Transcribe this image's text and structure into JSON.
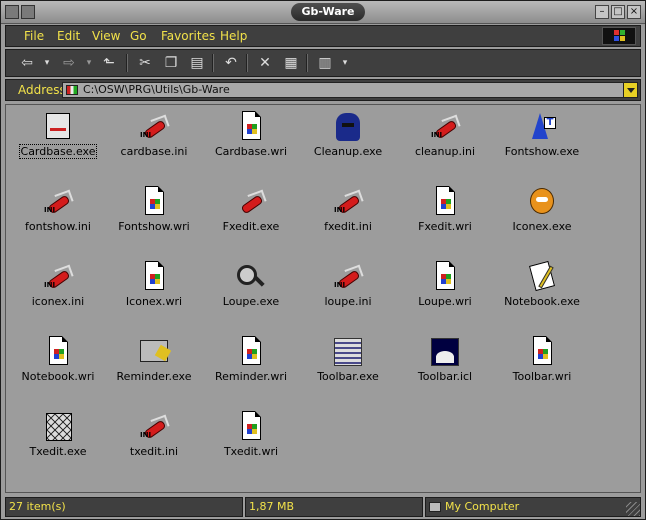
{
  "window": {
    "title": "Gb-Ware"
  },
  "menu": [
    {
      "label": "File"
    },
    {
      "label": "Edit"
    },
    {
      "label": "View"
    },
    {
      "label": "Go"
    },
    {
      "label": "Favorites"
    },
    {
      "label": "Help"
    }
  ],
  "address": {
    "label": "Address",
    "value": "C:\\OSW\\PRG\\Utils\\Gb-Ware"
  },
  "files": [
    {
      "name": "Cardbase.exe",
      "icon": "cardbase-icon",
      "selected": true
    },
    {
      "name": "cardbase.ini",
      "icon": "ini-knife-icon"
    },
    {
      "name": "Cardbase.wri",
      "icon": "wri-document-icon"
    },
    {
      "name": "Cleanup.exe",
      "icon": "spy-icon"
    },
    {
      "name": "cleanup.ini",
      "icon": "ini-knife-icon"
    },
    {
      "name": "Fontshow.exe",
      "icon": "wizard-icon"
    },
    {
      "name": "fontshow.ini",
      "icon": "ini-knife-icon"
    },
    {
      "name": "Fontshow.wri",
      "icon": "wri-document-icon"
    },
    {
      "name": "Fxedit.exe",
      "icon": "knife-icon"
    },
    {
      "name": "fxedit.ini",
      "icon": "ini-knife-icon"
    },
    {
      "name": "Fxedit.wri",
      "icon": "wri-document-icon"
    },
    {
      "name": "Iconex.exe",
      "icon": "garfield-icon"
    },
    {
      "name": "iconex.ini",
      "icon": "ini-knife-icon"
    },
    {
      "name": "Iconex.wri",
      "icon": "wri-document-icon"
    },
    {
      "name": "Loupe.exe",
      "icon": "magnifier-icon"
    },
    {
      "name": "loupe.ini",
      "icon": "ini-knife-icon"
    },
    {
      "name": "Loupe.wri",
      "icon": "wri-document-icon"
    },
    {
      "name": "Notebook.exe",
      "icon": "notebook-icon"
    },
    {
      "name": "Notebook.wri",
      "icon": "wri-document-icon"
    },
    {
      "name": "Reminder.exe",
      "icon": "reminder-icon"
    },
    {
      "name": "Reminder.wri",
      "icon": "wri-document-icon"
    },
    {
      "name": "Toolbar.exe",
      "icon": "toolbar-icon"
    },
    {
      "name": "Toolbar.icl",
      "icon": "icon-library-icon"
    },
    {
      "name": "Toolbar.wri",
      "icon": "wri-document-icon"
    },
    {
      "name": "Txedit.exe",
      "icon": "txedit-icon"
    },
    {
      "name": "txedit.ini",
      "icon": "ini-knife-icon"
    },
    {
      "name": "Txedit.wri",
      "icon": "wri-document-icon"
    }
  ],
  "status": {
    "count": "27 item(s)",
    "size": "1,87 MB",
    "location": "My Computer"
  },
  "colors": {
    "menu_text": "#f2e24a",
    "panel": "#3f3f3f",
    "content_bg": "#9c9c9c"
  }
}
